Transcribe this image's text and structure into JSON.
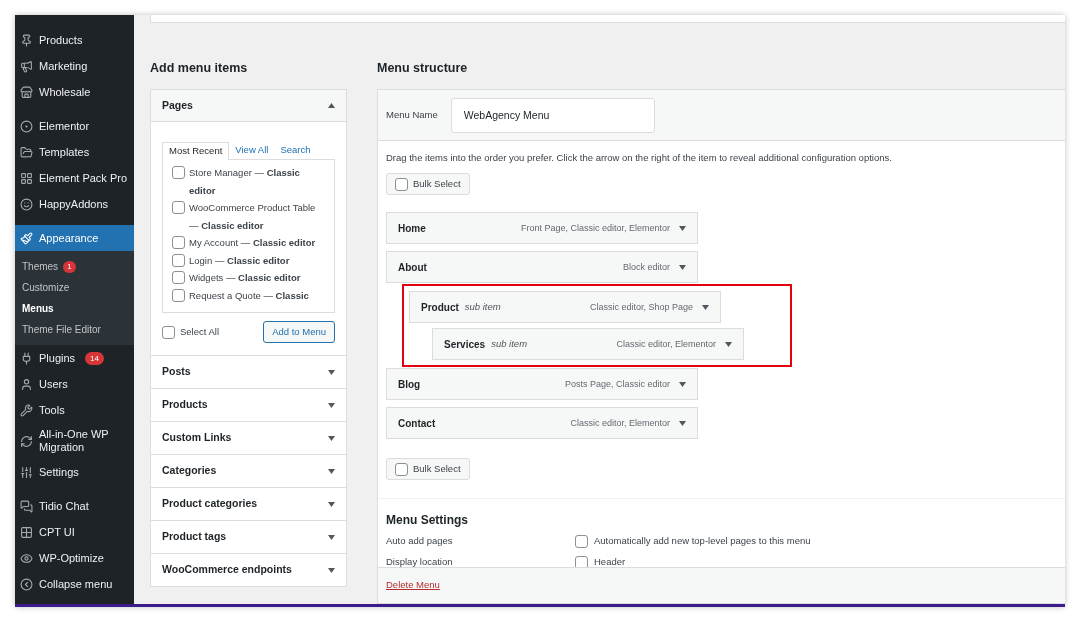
{
  "sidebar": {
    "items": [
      {
        "label": "Products",
        "selected": false
      },
      {
        "label": "Marketing",
        "selected": false
      },
      {
        "label": "Wholesale",
        "selected": false
      },
      {
        "label": "Elementor",
        "selected": false
      },
      {
        "label": "Templates",
        "selected": false
      },
      {
        "label": "Element Pack Pro",
        "selected": false
      },
      {
        "label": "HappyAddons",
        "selected": false
      },
      {
        "label": "Appearance",
        "selected": true,
        "children": [
          {
            "label": "Themes",
            "badge": "1",
            "selected": false
          },
          {
            "label": "Customize",
            "selected": false
          },
          {
            "label": "Menus",
            "selected": true
          },
          {
            "label": "Theme File Editor",
            "selected": false
          }
        ]
      },
      {
        "label": "Plugins",
        "badge": "14",
        "selected": false
      },
      {
        "label": "Users",
        "selected": false
      },
      {
        "label": "Tools",
        "selected": false
      },
      {
        "label": "All-in-One WP Migration",
        "selected": false
      },
      {
        "label": "Settings",
        "selected": false
      },
      {
        "label": "Tidio Chat",
        "selected": false
      },
      {
        "label": "CPT UI",
        "selected": false
      },
      {
        "label": "WP-Optimize",
        "selected": false
      },
      {
        "label": "Collapse menu",
        "selected": false
      }
    ]
  },
  "add_menu_items": {
    "title": "Add menu items",
    "panels": [
      {
        "title": "Pages",
        "expanded": true,
        "tabs": [
          {
            "label": "Most Recent",
            "selected": true
          },
          {
            "label": "View All",
            "selected": false
          },
          {
            "label": "Search",
            "selected": false
          }
        ],
        "items": [
          {
            "label": "Store Manager — **Classic editor**",
            "checked": false
          },
          {
            "label": "WooCommerce Product Table — **Classic editor**",
            "checked": false
          },
          {
            "label": "My Account — **Classic editor**",
            "checked": false
          },
          {
            "label": "Login — **Classic editor**",
            "checked": false
          },
          {
            "label": "Widgets — **Classic editor**",
            "checked": false
          },
          {
            "label": "Request a Quote — **Classic**",
            "checked": false
          }
        ],
        "select_all": {
          "label": "Select All",
          "checked": false
        },
        "add_button": "Add to Menu"
      },
      {
        "title": "Posts",
        "expanded": false
      },
      {
        "title": "Products",
        "expanded": false
      },
      {
        "title": "Custom Links",
        "expanded": false
      },
      {
        "title": "Categories",
        "expanded": false
      },
      {
        "title": "Product categories",
        "expanded": false
      },
      {
        "title": "Product tags",
        "expanded": false
      },
      {
        "title": "WooCommerce endpoints",
        "expanded": false
      }
    ]
  },
  "menu_structure": {
    "title": "Menu structure",
    "menu_name": {
      "label": "Menu Name",
      "value": "WebAgency Menu"
    },
    "instructions": "Drag the items into the order you prefer. Click the arrow on the right of the item to reveal additional configuration options.",
    "bulk_select_top": {
      "label": "Bulk Select",
      "checked": false
    },
    "items": [
      {
        "title": "Home",
        "type": "Front Page, Classic editor, Elementor"
      },
      {
        "title": "About",
        "type": "Block editor",
        "children_highlighted": true,
        "children": [
          {
            "title": "Product",
            "sub_label": "sub item",
            "type": "Classic editor, Shop Page",
            "children": [
              {
                "title": "Services",
                "sub_label": "sub item",
                "type": "Classic editor, Elementor"
              }
            ]
          }
        ]
      },
      {
        "title": "Blog",
        "type": "Posts Page, Classic editor"
      },
      {
        "title": "Contact",
        "type": "Classic editor, Elementor"
      }
    ],
    "bulk_select_bottom": {
      "label": "Bulk Select",
      "checked": false
    },
    "settings": {
      "title": "Menu Settings",
      "rows": [
        {
          "label": "Auto add pages",
          "option": "Automatically add new top-level pages to this menu",
          "checked": false
        },
        {
          "label": "Display location",
          "option": "Header",
          "checked": false
        }
      ]
    },
    "delete_link": "Delete Menu"
  }
}
